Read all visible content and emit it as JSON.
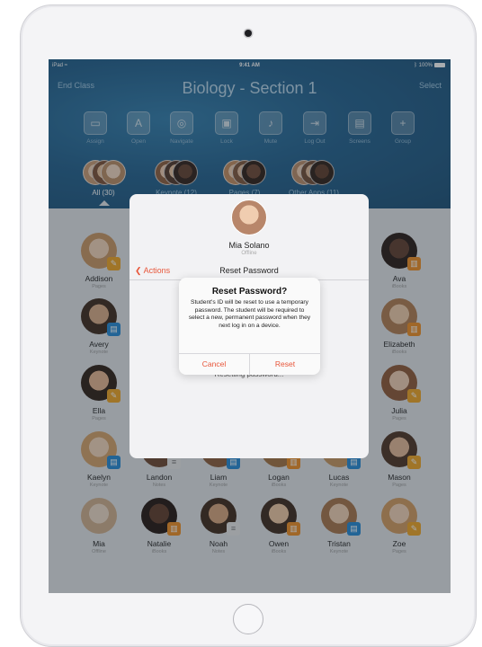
{
  "status_bar": {
    "device": "iPad",
    "wifi_icon": "wifi-icon",
    "time": "9:41 AM",
    "bluetooth_icon": "bluetooth-icon",
    "battery": "100%"
  },
  "header": {
    "end_class_label": "End Class",
    "title": "Biology - Section 1",
    "select_label": "Select"
  },
  "toolbar": [
    {
      "label": "Assign",
      "icon": "assign-icon",
      "glyph": "▭"
    },
    {
      "label": "Open",
      "icon": "open-app-icon",
      "glyph": "A"
    },
    {
      "label": "Navigate",
      "icon": "compass-icon",
      "glyph": "◎"
    },
    {
      "label": "Lock",
      "icon": "lock-icon",
      "glyph": "▣"
    },
    {
      "label": "Mute",
      "icon": "mute-bell-icon",
      "glyph": "♪"
    },
    {
      "label": "Log Out",
      "icon": "log-out-icon",
      "glyph": "⇥"
    },
    {
      "label": "Screens",
      "icon": "screens-icon",
      "glyph": "▤"
    },
    {
      "label": "Group",
      "icon": "add-group-icon",
      "glyph": "+"
    }
  ],
  "groups": [
    {
      "label": "All (30)",
      "active": true
    },
    {
      "label": "Keynote (12)",
      "active": false
    },
    {
      "label": "Pages (7)",
      "active": false
    },
    {
      "label": "Other Apps (11)",
      "active": false
    }
  ],
  "colors": {
    "accent": "#e8563a",
    "keynote_badge": "#1f87d6",
    "pages_badge": "#f0a31e",
    "books_badge": "#f08c1e",
    "notes_badge": "#e9e9e9"
  },
  "students": [
    {
      "name": "Addison",
      "status": "Pages",
      "badge": "pages-badge-icon"
    },
    {
      "name": "Ava",
      "status": "iBooks",
      "badge": "books-badge-icon"
    },
    {
      "name": "Avery",
      "status": "Keynote",
      "badge": "keynote-badge-icon"
    },
    {
      "name": "Elizabeth",
      "status": "iBooks",
      "badge": "books-badge-icon"
    },
    {
      "name": "Ella",
      "status": "Pages",
      "badge": "pages-badge-icon"
    },
    {
      "name": "Julia",
      "status": "Pages",
      "badge": "pages-badge-icon"
    },
    {
      "name": "Kaelyn",
      "status": "Keynote",
      "badge": "keynote-badge-icon"
    },
    {
      "name": "Landon",
      "status": "Notes",
      "badge": "notes-badge-icon"
    },
    {
      "name": "Liam",
      "status": "Keynote",
      "badge": "keynote-badge-icon"
    },
    {
      "name": "Logan",
      "status": "iBooks",
      "badge": "books-badge-icon"
    },
    {
      "name": "Lucas",
      "status": "Keynote",
      "badge": "keynote-badge-icon"
    },
    {
      "name": "Mason",
      "status": "Pages",
      "badge": "pages-badge-icon"
    },
    {
      "name": "Mia",
      "status": "Offline",
      "badge": ""
    },
    {
      "name": "Natalie",
      "status": "iBooks",
      "badge": "books-badge-icon"
    },
    {
      "name": "Noah",
      "status": "Notes",
      "badge": "notes-badge-icon"
    },
    {
      "name": "Owen",
      "status": "iBooks",
      "badge": "books-badge-icon"
    },
    {
      "name": "Tristan",
      "status": "Keynote",
      "badge": "keynote-badge-icon"
    },
    {
      "name": "Zoe",
      "status": "Pages",
      "badge": "pages-badge-icon"
    }
  ],
  "sheet": {
    "student_name": "Mia Solano",
    "student_status": "Offline",
    "back_label": "Actions",
    "title": "Reset Password",
    "progress_text": "Resetting password..."
  },
  "alert": {
    "title": "Reset Password?",
    "message": "Student's ID will be reset to use a temporary password. The student will be required to select a new, permanent password when they next log in on a device.",
    "cancel_label": "Cancel",
    "confirm_label": "Reset"
  }
}
